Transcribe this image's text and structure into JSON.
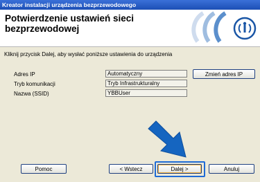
{
  "titlebar": {
    "title": "Kreator instalacji urządzenia bezprzewodowego"
  },
  "header": {
    "title": "Potwierdzenie ustawień sieci bezprzewodowej"
  },
  "instruction": "Kliknij przycisk Dalej, aby wysłać poniższe ustawienia do urządzenia",
  "settings": [
    {
      "label": "Adres IP",
      "value": "Automatyczny"
    },
    {
      "label": "Tryb komunikacji",
      "value": "Tryb Infrastrukturalny"
    },
    {
      "label": "Nazwa (SSID)",
      "value": "YBBUser"
    }
  ],
  "buttons": {
    "change_ip": "Zmień adres IP",
    "help": "Pomoc",
    "back": "< Wstecz",
    "next": "Dalej >",
    "cancel": "Anuluj"
  },
  "colors": {
    "titlebar": "#1d4fb5",
    "dialog_bg": "#ece9d8",
    "arrow": "#1565c0",
    "logo": "#1a56a6"
  },
  "icons": {
    "logo": "wireless-signal-icon",
    "arrow": "pointer-arrow-icon"
  }
}
